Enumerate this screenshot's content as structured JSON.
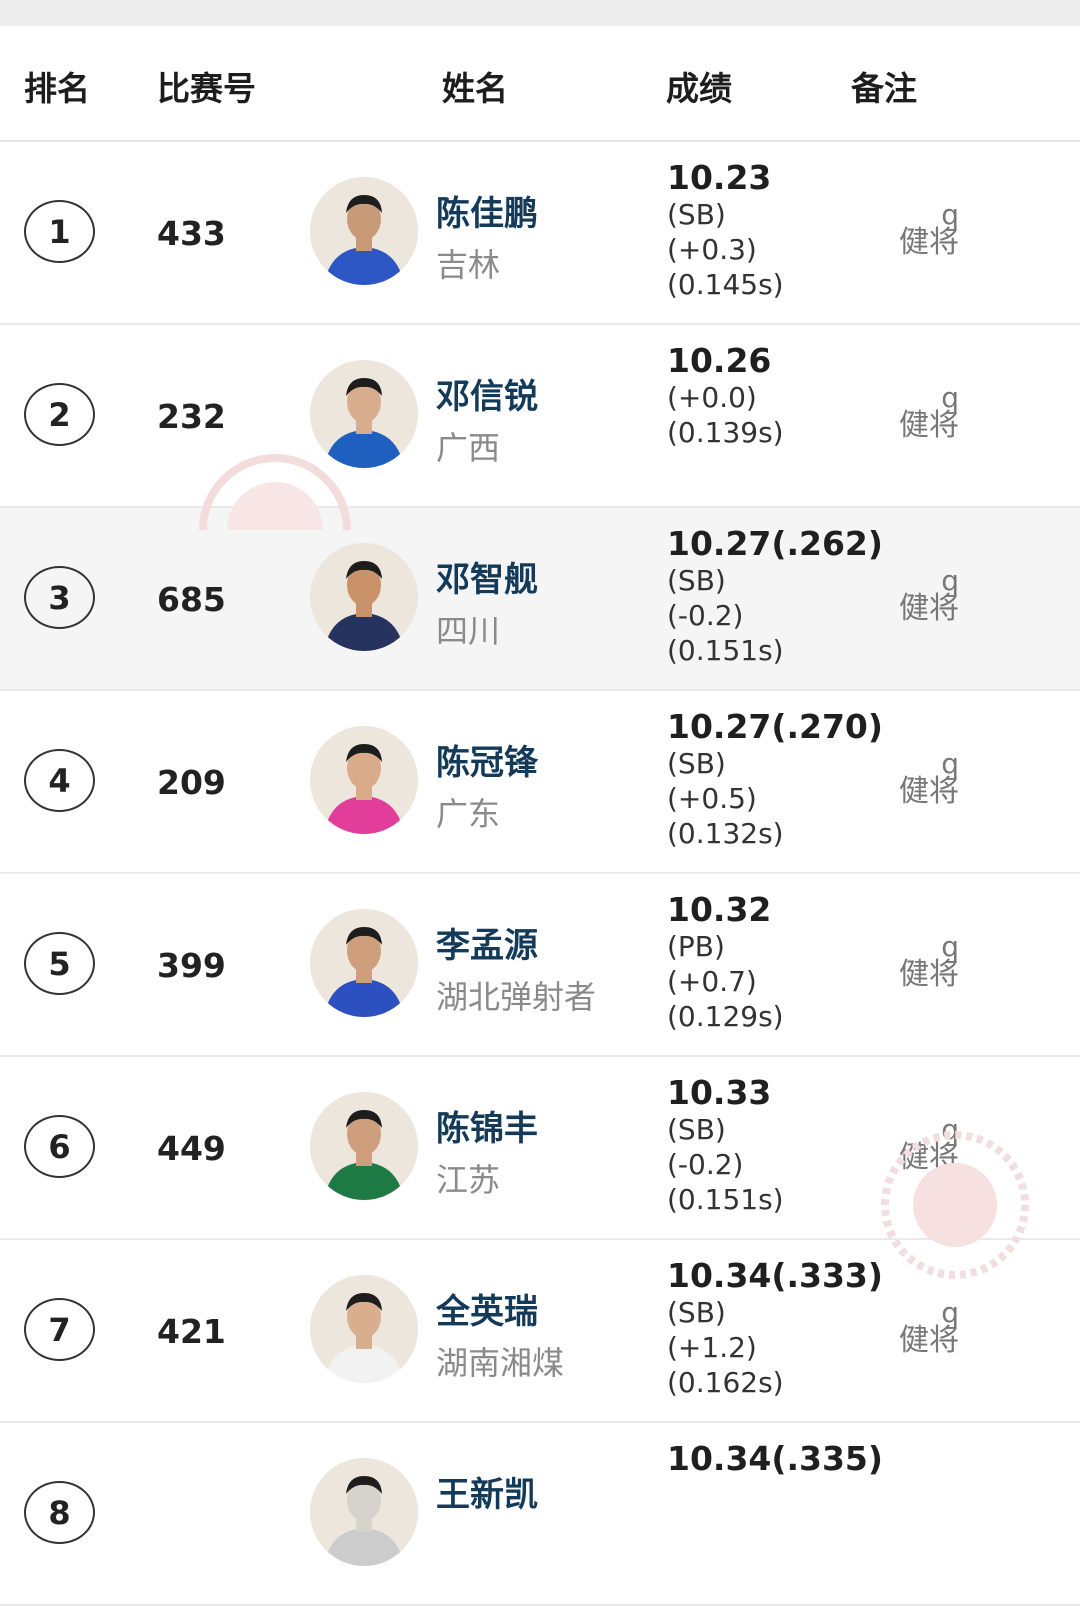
{
  "header": {
    "rank": "排名",
    "bib": "比赛号",
    "name": "姓名",
    "result": "成绩",
    "note": "备注"
  },
  "rows": [
    {
      "rank": "1",
      "bib": "433",
      "name": "陈佳鹏",
      "team": "吉林",
      "time": "10.23",
      "details": [
        "(SB)",
        "(+0.3)",
        "(0.145s)"
      ],
      "qual": "q",
      "mark": "健将",
      "shade": false,
      "jersey": "#2c56c4",
      "skin": "#c89a78"
    },
    {
      "rank": "2",
      "bib": "232",
      "name": "邓信锐",
      "team": "广西",
      "time": "10.26",
      "details": [
        "(+0.0)",
        "(0.139s)"
      ],
      "qual": "q",
      "mark": "健将",
      "shade": false,
      "jersey": "#1f5fbf",
      "skin": "#d7ad8d"
    },
    {
      "rank": "3",
      "bib": "685",
      "name": "邓智舰",
      "team": "四川",
      "time": "10.27(.262)",
      "details": [
        "(SB)",
        "(-0.2)",
        "(0.151s)"
      ],
      "qual": "q",
      "mark": "健将",
      "shade": true,
      "jersey": "#26335e",
      "skin": "#c9926b"
    },
    {
      "rank": "4",
      "bib": "209",
      "name": "陈冠锋",
      "team": "广东",
      "time": "10.27(.270)",
      "details": [
        "(SB)",
        "(+0.5)",
        "(0.132s)"
      ],
      "qual": "q",
      "mark": "健将",
      "shade": false,
      "jersey": "#e23d9a",
      "skin": "#d9ab8a"
    },
    {
      "rank": "5",
      "bib": "399",
      "name": "李孟源",
      "team": "湖北弹射者",
      "time": "10.32",
      "details": [
        "(PB)",
        "(+0.7)",
        "(0.129s)"
      ],
      "qual": "q",
      "mark": "健将",
      "shade": false,
      "jersey": "#2d50c0",
      "skin": "#cf9f7d"
    },
    {
      "rank": "6",
      "bib": "449",
      "name": "陈锦丰",
      "team": "江苏",
      "time": "10.33",
      "details": [
        "(SB)",
        "(-0.2)",
        "(0.151s)"
      ],
      "qual": "q",
      "mark": "健将",
      "shade": false,
      "jersey": "#1e7a44",
      "skin": "#cf9f7d"
    },
    {
      "rank": "7",
      "bib": "421",
      "name": "全英瑞",
      "team": "湖南湘煤",
      "time": "10.34(.333)",
      "details": [
        "(SB)",
        "(+1.2)",
        "(0.162s)"
      ],
      "qual": "q",
      "mark": "健将",
      "shade": false,
      "jersey": "#f2f2f2",
      "skin": "#d8ae8e"
    },
    {
      "rank": "8",
      "bib": "",
      "name": "王新凯",
      "team": "",
      "time": "10.34(.335)",
      "details": [],
      "qual": "",
      "mark": "",
      "shade": false,
      "jersey": "#cccccc",
      "skin": "#d6d2cc"
    }
  ]
}
